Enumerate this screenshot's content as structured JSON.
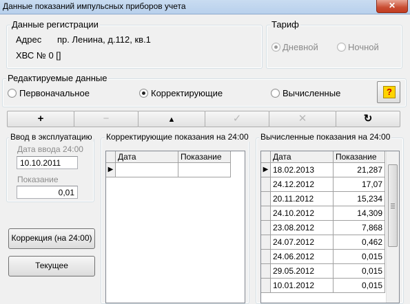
{
  "window": {
    "title": "Данные показаний импульсных приборов учета",
    "close_label": "✕"
  },
  "registration": {
    "legend": "Данные регистрации",
    "address_label": "Адрес",
    "address_value": "пр. Ленина, д.112, кв.1",
    "meter": "ХВС № 0 []"
  },
  "tariff": {
    "legend": "Тариф",
    "options": [
      {
        "label": "Дневной",
        "checked": true
      },
      {
        "label": "Ночной",
        "checked": false
      }
    ]
  },
  "edit": {
    "legend": "Редактируемые данные",
    "options": [
      {
        "label": "Первоначальное",
        "checked": false
      },
      {
        "label": "Корректирующие",
        "checked": true
      },
      {
        "label": "Вычисленные",
        "checked": false
      }
    ],
    "help_label": "?"
  },
  "toolbar": [
    {
      "icon": "plus-icon",
      "glyph": "+",
      "enabled": true
    },
    {
      "icon": "minus-icon",
      "glyph": "−",
      "enabled": false
    },
    {
      "icon": "triangle-up-icon",
      "glyph": "▲",
      "enabled": true
    },
    {
      "icon": "check-icon",
      "glyph": "✓",
      "enabled": false
    },
    {
      "icon": "cancel-icon",
      "glyph": "✕",
      "enabled": false
    },
    {
      "icon": "refresh-icon",
      "glyph": "↻",
      "enabled": true
    }
  ],
  "commissioning": {
    "legend": "Ввод в эксплуатацию",
    "date_label": "Дата ввода 24:00",
    "date_value": "10.10.2011",
    "reading_label": "Показание",
    "reading_value": "0,01"
  },
  "buttons": {
    "correction": "Коррекция (на 24:00)",
    "current": "Текущее"
  },
  "corrective": {
    "legend": "Корректирующие показания на 24:00",
    "columns": [
      "Дата",
      "Показание"
    ],
    "rows": [
      {
        "date": "",
        "value": ""
      }
    ]
  },
  "computed": {
    "legend": "Вычисленные показания на 24:00",
    "columns": [
      "Дата",
      "Показание"
    ],
    "rows": [
      {
        "date": "18.02.2013",
        "value": "21,287"
      },
      {
        "date": "24.12.2012",
        "value": "17,07"
      },
      {
        "date": "20.11.2012",
        "value": "15,234"
      },
      {
        "date": "24.10.2012",
        "value": "14,309"
      },
      {
        "date": "23.08.2012",
        "value": "7,868"
      },
      {
        "date": "24.07.2012",
        "value": "0,462"
      },
      {
        "date": "24.06.2012",
        "value": "0,015"
      },
      {
        "date": "29.05.2012",
        "value": "0,015"
      },
      {
        "date": "10.01.2012",
        "value": "0,015"
      }
    ]
  }
}
